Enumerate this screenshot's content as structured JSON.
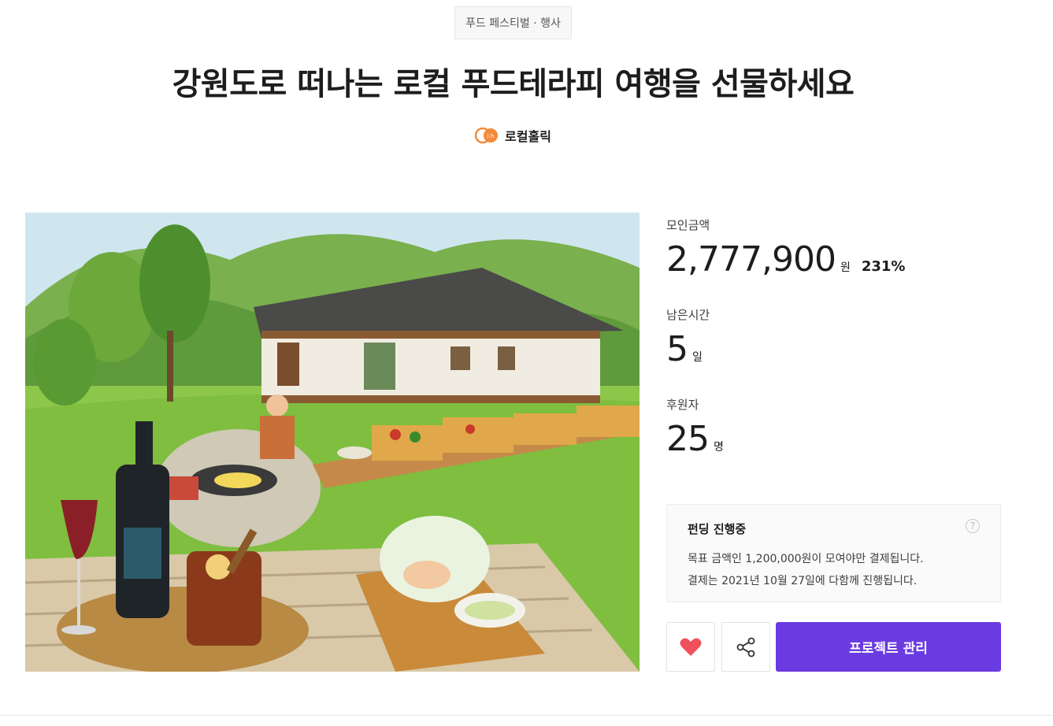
{
  "header": {
    "category": "푸드 페스티벌 · 행사",
    "title": "강원도로 떠나는 로컬 푸드테라피 여행을 선물하세요",
    "creator_name": "로컬홀릭",
    "creator_logo_text": "l.h"
  },
  "stats": {
    "amount_label": "모인금액",
    "amount_value": "2,777,900",
    "amount_unit": "원",
    "amount_percent": "231%",
    "time_label": "남은시간",
    "time_value": "5",
    "time_unit": "일",
    "backers_label": "후원자",
    "backers_value": "25",
    "backers_unit": "명"
  },
  "funding_info": {
    "title": "펀딩 진행중",
    "line1": "목표 금액인 1,200,000원이 모여야만 결제됩니다.",
    "line2": "결제는 2021년 10월 27일에 다함께 진행됩니다.",
    "help_glyph": "?"
  },
  "actions": {
    "like_icon": "heart-icon",
    "share_icon": "share-icon",
    "manage_label": "프로젝트 관리"
  },
  "colors": {
    "accent": "#6a3be0",
    "like": "#f0505b",
    "logo": "#f28a3a"
  }
}
